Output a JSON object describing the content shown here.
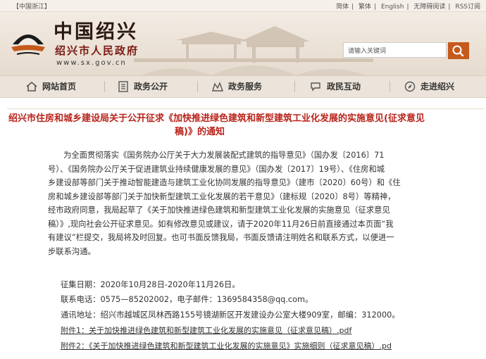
{
  "topbar": {
    "region_link": "【中国浙江】",
    "links": [
      "简体",
      "繁体",
      "English",
      "无障碍阅读",
      "RSS订阅"
    ],
    "separator": "|"
  },
  "header": {
    "site_title": "中国绍兴",
    "site_subtitle": "绍兴市人民政府",
    "site_url": "www.sx.gov.cn",
    "logo_icon": "boat-canopy-logo",
    "search_placeholder": "请输入关键词",
    "search_icon": "search-icon",
    "accent_color": "#c45a1b"
  },
  "nav": {
    "items": [
      {
        "label": "网站首页",
        "icon": "home-icon"
      },
      {
        "label": "政务公开",
        "icon": "document-list-icon"
      },
      {
        "label": "政务服务",
        "icon": "service-icon"
      },
      {
        "label": "政民互动",
        "icon": "chat-icon"
      },
      {
        "label": "走进绍兴",
        "icon": "compass-icon"
      }
    ]
  },
  "article": {
    "title_line1": "绍兴市住房和城乡建设局关于公开征求《加快推进绿色建筑和新型建筑工业化发展的实施意见(征求意见",
    "title_line2": "稿)》的通知",
    "title_color": "#b8241c",
    "body_lines": [
      "为全面贯彻落实《国务院办公厅关于大力发展装配式建筑的指导意见》（国办发〔2016〕71",
      "号）、《国务院办公厅关于促进建筑业持续健康发展的意见》（国办发〔2017〕19号）、《住房和城",
      "乡建设部等部门关于推动智能建造与建筑工业化协同发展的指导意见》（建市〔2020〕60号）和《住",
      "房和城乡建设部等部门关于加快新型建筑工业化发展的若干意见》（建标规〔2020〕8号）等精神，",
      "经市政府同意，我局起草了《关于加快推进绿色建筑和新型建筑工业化发展的实施意见（征求意见",
      "稿）》,现向社会公开征求意见。如有修改意见或建议，请于2020年11月26日前直接通过本页面“我",
      "有建议”栏提交，我局将及时回复。也可书面反馈我局，书面反馈请注明姓名和联系方式，以便进一",
      "步联系沟通。"
    ],
    "period": "征集日期：2020年10月28日-2020年11月26日。",
    "contact": "联系电话：0575—85202002，电子邮件：1369584358@qq.com。",
    "address": "通讯地址：绍兴市越城区凤林西路155号镜湖新区开发建设办公室大楼909室，邮编：312000。",
    "attachments": [
      "附件1：关于加快推进绿色建筑和新型建筑工业化发展的实施意见（征求意见稿）.pdf",
      "附件2：《关于加快推进绿色建筑和新型建筑工业化发展的实施意见》实施细则（征求意见稿）.pd"
    ]
  }
}
